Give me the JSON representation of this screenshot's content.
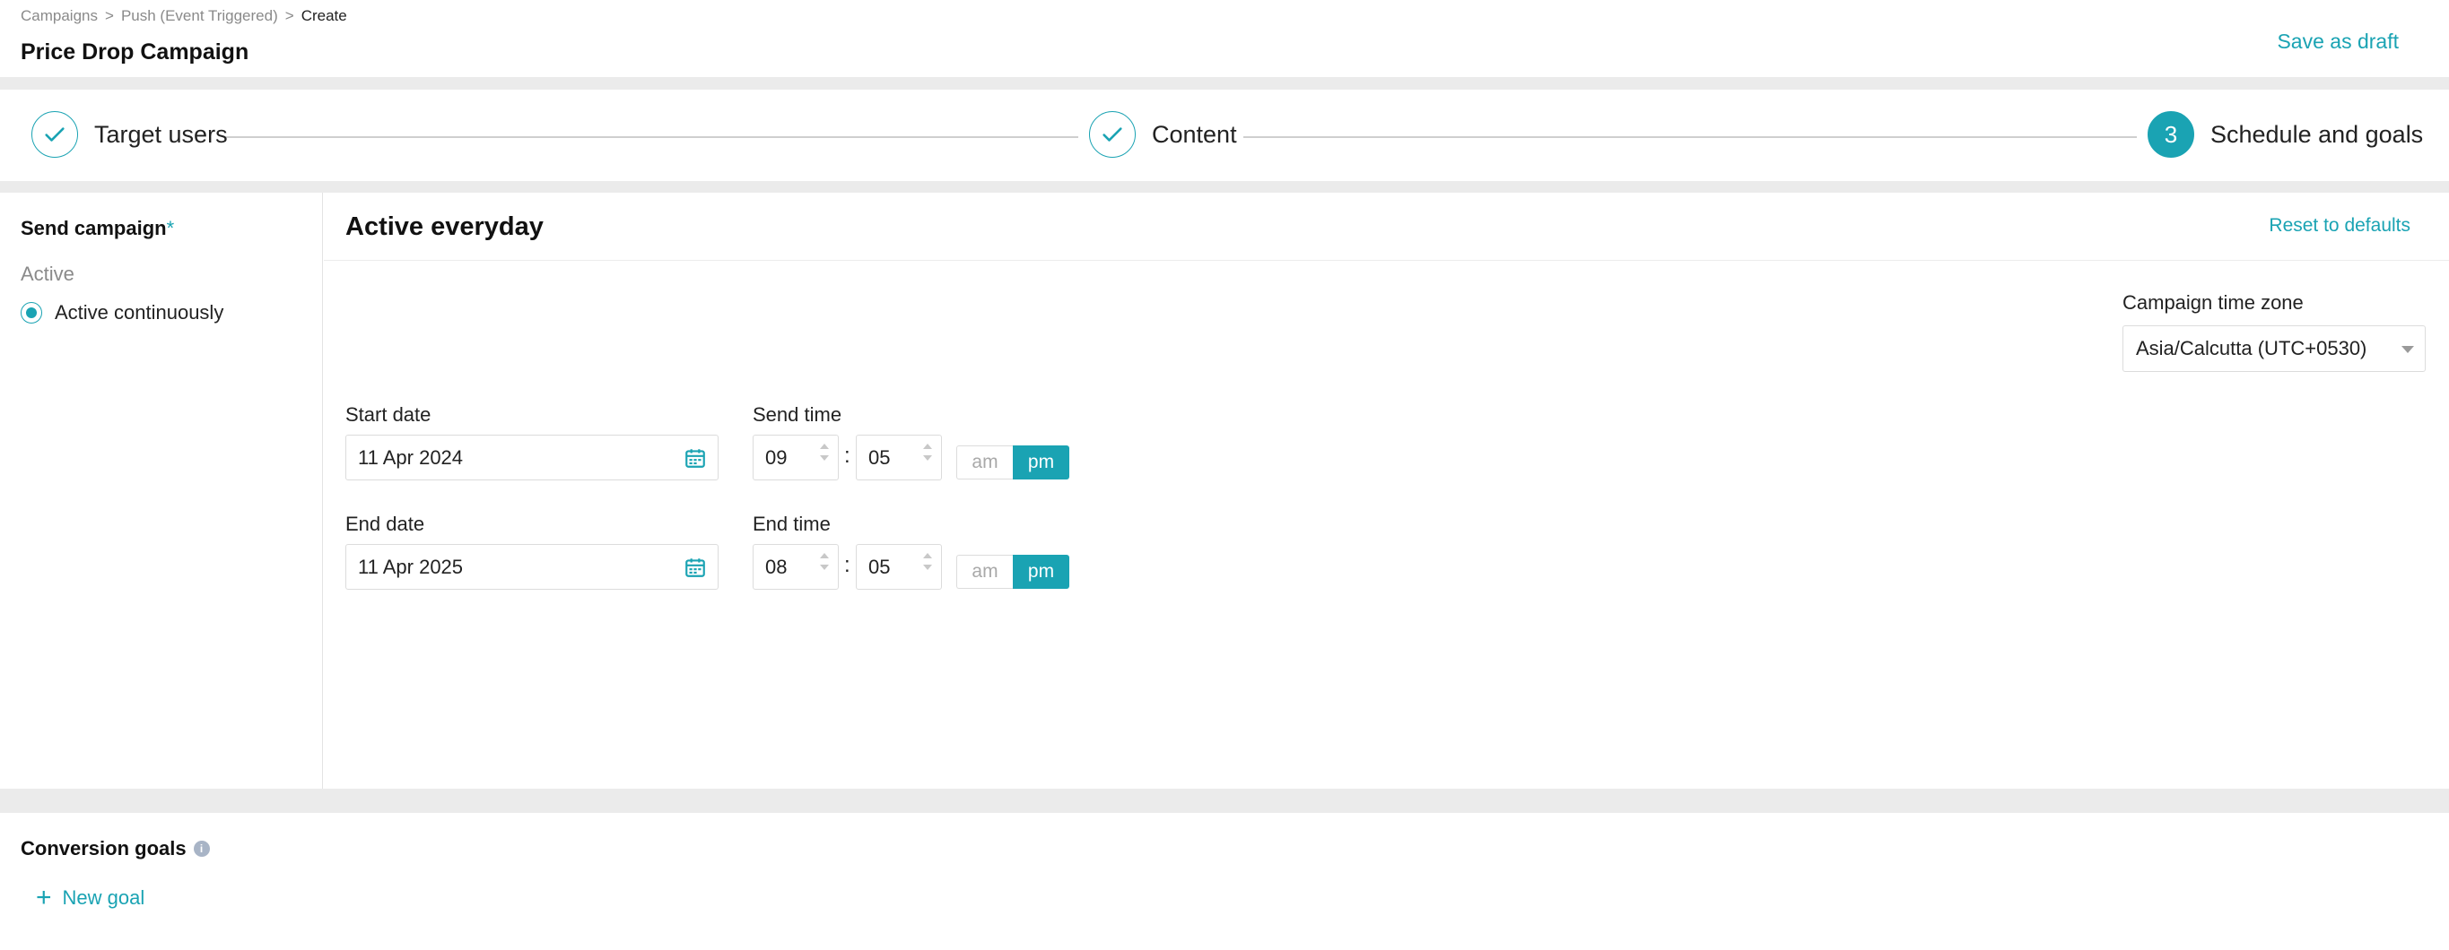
{
  "header": {
    "breadcrumb": [
      "Campaigns",
      ">",
      "Push (Event Triggered)",
      "> ",
      "Create"
    ],
    "title": "Price Drop Campaign",
    "save_draft": "Save as draft"
  },
  "stepper": {
    "steps": [
      {
        "label": "Target users",
        "state": "done"
      },
      {
        "label": "Content",
        "state": "done"
      },
      {
        "label": "Schedule and goals",
        "state": "active",
        "number": "3"
      }
    ]
  },
  "schedule": {
    "send_campaign_label": "Send campaign",
    "required_mark": "*",
    "active_label": "Active",
    "option_active_continuously": "Active continuously",
    "section_title": "Active everyday",
    "reset_label": "Reset to defaults",
    "timezone_label": "Campaign time zone",
    "timezone_value": "Asia/Calcutta (UTC+0530)",
    "start_date_label": "Start date",
    "start_date_value": "11 Apr 2024",
    "send_time_label": "Send time",
    "send_hour": "09",
    "send_minute": "05",
    "end_date_label": "End date",
    "end_date_value": "11 Apr 2025",
    "end_time_label": "End time",
    "end_hour": "08",
    "end_minute": "05",
    "am": "am",
    "pm": "pm",
    "colon": ":"
  },
  "goals": {
    "title": "Conversion goals",
    "info": "i",
    "new_goal": "New goal",
    "plus": "+"
  },
  "colors": {
    "accent": "#1aa3b3",
    "muted_text": "#8a8a8a",
    "border": "#dcdcdc",
    "background": "#ebebeb"
  }
}
